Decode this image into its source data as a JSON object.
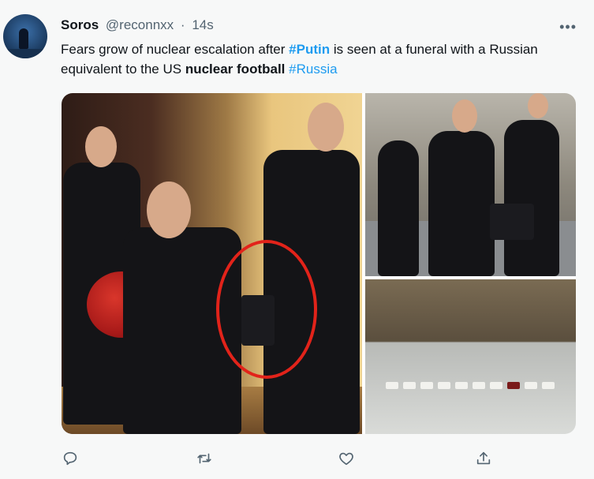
{
  "tweet": {
    "author_name": "Soros",
    "author_handle": "@reconnxx",
    "separator": "·",
    "time": "14s",
    "text_parts": {
      "p1": "Fears grow of nuclear escalation after ",
      "tag_putin": "#Putin",
      "p2": " is seen at a funeral with a Russian equivalent to the US ",
      "bold": "nuclear football",
      "p3": " ",
      "tag_russia": "#Russia"
    },
    "more_label": "•••"
  },
  "colors": {
    "accent": "#1d9bf0",
    "text": "#0f1419",
    "muted": "#536471",
    "highlight_circle": "#e2231a"
  },
  "icons": {
    "reply": "reply-icon",
    "retweet": "retweet-icon",
    "like": "like-icon",
    "share": "share-icon",
    "more": "more-icon"
  }
}
